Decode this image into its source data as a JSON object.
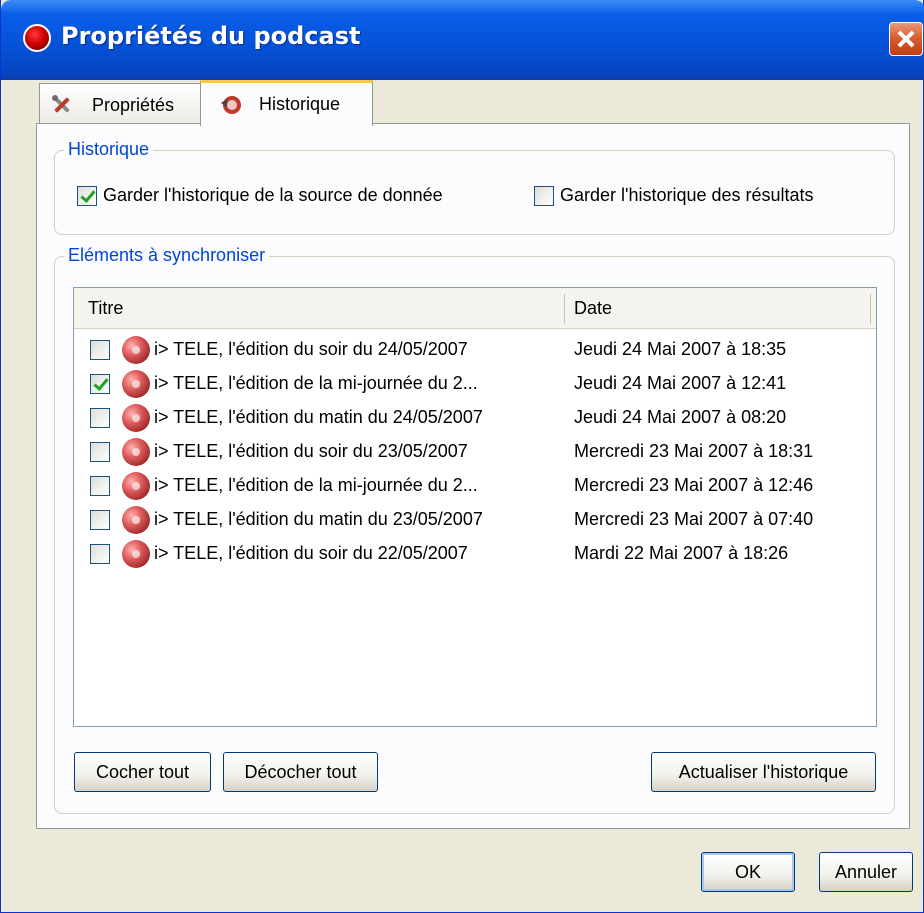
{
  "window": {
    "title": "Propriétés du podcast",
    "accent": "#0553d8"
  },
  "tabs": [
    {
      "label": "Propriétés",
      "icon": "tools-icon",
      "active": false
    },
    {
      "label": "Historique",
      "icon": "history-icon",
      "active": true
    }
  ],
  "history_group": {
    "legend": "Historique",
    "keep_source_history": {
      "label": "Garder l'historique de la source de donnée",
      "checked": true
    },
    "keep_results_history": {
      "label": "Garder l'historique des résultats",
      "checked": false
    }
  },
  "sync_group": {
    "legend": "Eléments à synchroniser",
    "columns": [
      "Titre",
      "Date"
    ],
    "rows": [
      {
        "checked": false,
        "title": "i> TELE, l'édition du soir du 24/05/2007",
        "date": "Jeudi 24 Mai 2007 à 18:35"
      },
      {
        "checked": true,
        "title": "i> TELE, l'édition de la mi-journée du 2...",
        "date": "Jeudi 24 Mai 2007 à 12:41"
      },
      {
        "checked": false,
        "title": "i> TELE, l'édition du matin du 24/05/2007",
        "date": "Jeudi 24 Mai 2007 à 08:20"
      },
      {
        "checked": false,
        "title": "i> TELE, l'édition du soir du 23/05/2007",
        "date": "Mercredi 23 Mai 2007 à 18:31"
      },
      {
        "checked": false,
        "title": "i> TELE, l'édition de la mi-journée du 2...",
        "date": "Mercredi 23 Mai 2007 à 12:46"
      },
      {
        "checked": false,
        "title": "i> TELE, l'édition du matin du 23/05/2007",
        "date": "Mercredi 23 Mai 2007 à 07:40"
      },
      {
        "checked": false,
        "title": "i> TELE, l'édition du soir du 22/05/2007",
        "date": "Mardi 22 Mai 2007 à 18:26"
      }
    ],
    "buttons": {
      "check_all": "Cocher tout",
      "uncheck_all": "Décocher tout",
      "refresh_history": "Actualiser l'historique"
    }
  },
  "footer": {
    "ok": "OK",
    "cancel": "Annuler"
  }
}
